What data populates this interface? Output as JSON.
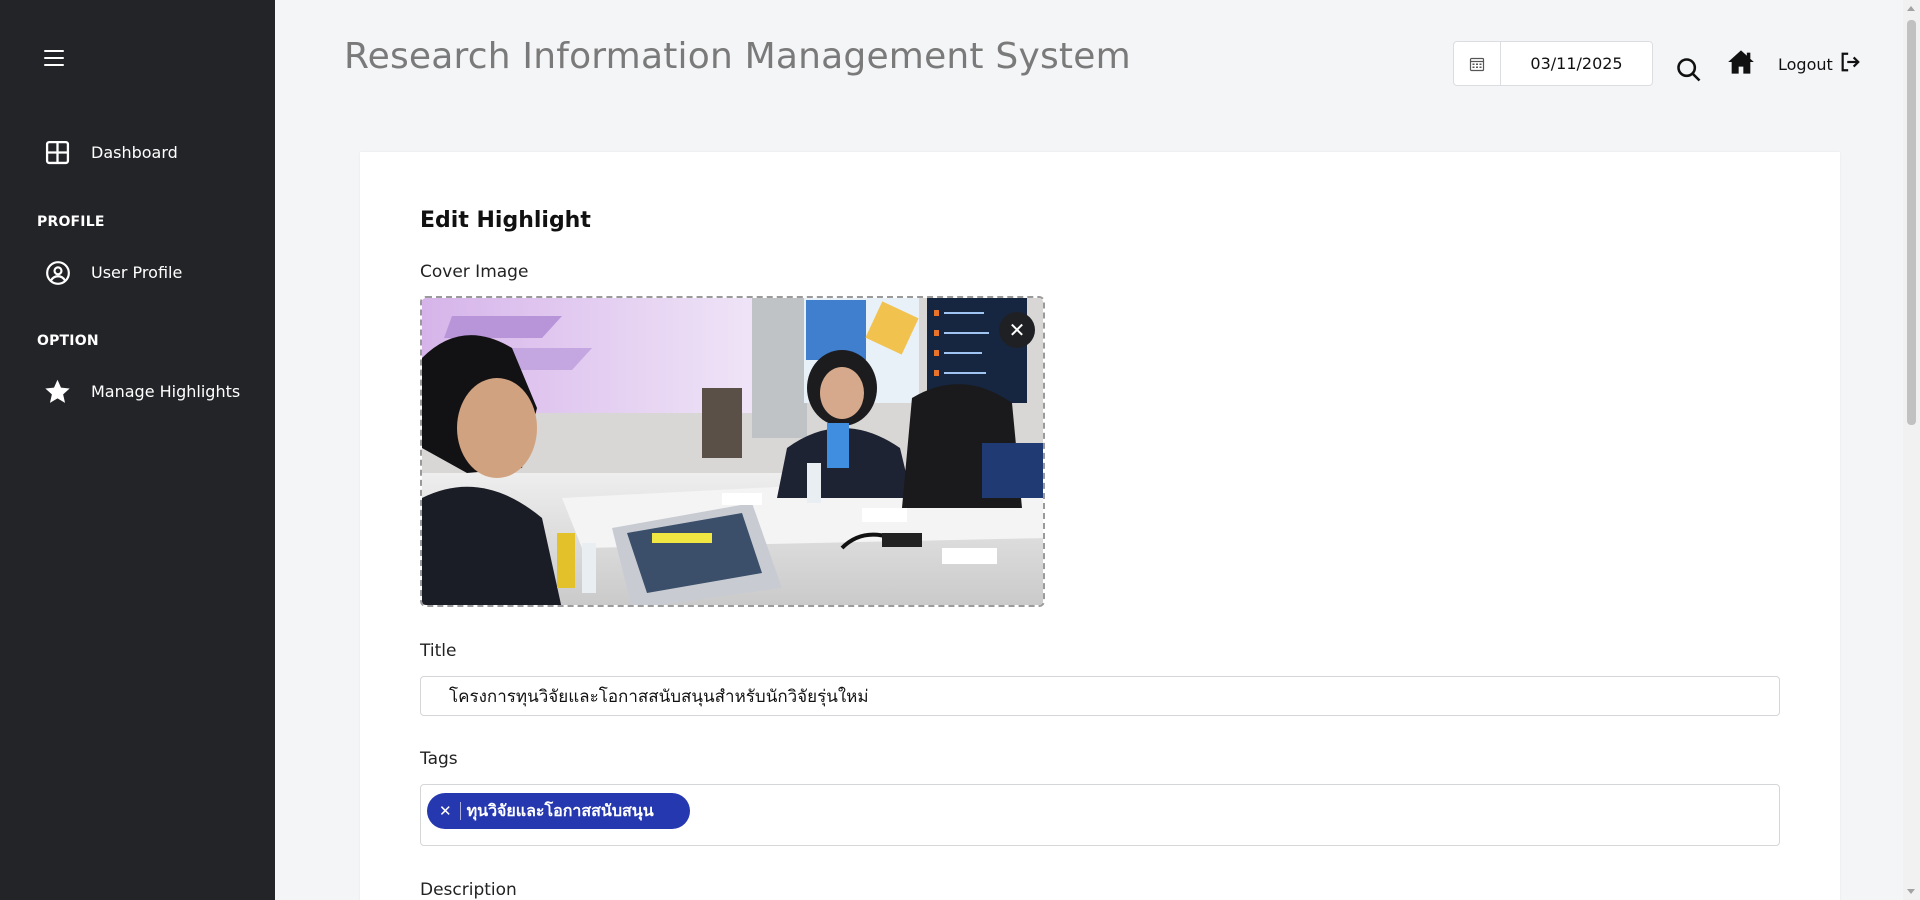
{
  "app": {
    "title": "Research Information Management System"
  },
  "header": {
    "date_value": "03/11/2025",
    "logout_label": "Logout"
  },
  "sidebar": {
    "dashboard_label": "Dashboard",
    "section_profile": "PROFILE",
    "user_profile_label": "User Profile",
    "section_option": "OPTION",
    "manage_highlights_label": "Manage Highlights"
  },
  "form": {
    "heading": "Edit Highlight",
    "cover_label": "Cover Image",
    "title_label": "Title",
    "title_value": "โครงการทุนวิจัยและโอกาสสนับสนุนสำหรับนักวิจัยรุ่นใหม่",
    "tags_label": "Tags",
    "tags": [
      "ทุนวิจัยและโอกาสสนับสนุน"
    ],
    "description_label": "Description"
  },
  "colors": {
    "sidebar_bg": "#232428",
    "tag_bg": "#2638b0",
    "page_bg": "#f4f5f7"
  },
  "icons": [
    "menu-icon",
    "dashboard-icon",
    "user-circle-icon",
    "star-icon",
    "calendar-icon",
    "search-icon",
    "home-icon",
    "logout-icon",
    "close-icon"
  ]
}
